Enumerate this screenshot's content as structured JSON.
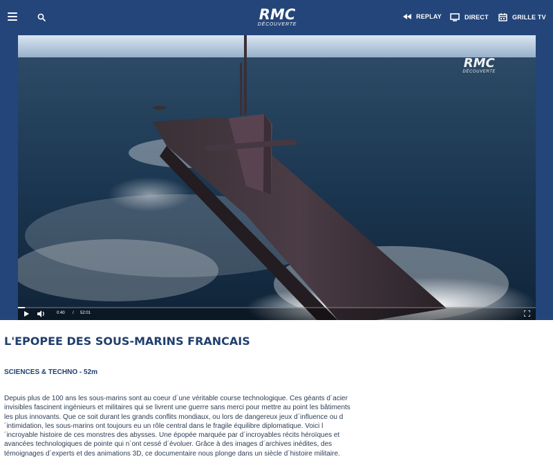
{
  "header": {
    "menu_icon": "hamburger-menu-icon",
    "search_icon": "search-icon",
    "logo": {
      "main": "RMC",
      "sub": "DÉCOUVERTE"
    },
    "nav": [
      {
        "label": "REPLAY",
        "icon": "rewind-icon"
      },
      {
        "label": "DIRECT",
        "icon": "tv-screen-icon"
      },
      {
        "label": "GRILLE TV",
        "icon": "calendar-icon"
      }
    ],
    "bg_color": "#23457a"
  },
  "player": {
    "watermark": {
      "main": "RMC",
      "sub": "DÉCOUVERTE"
    },
    "current_time": "0:40",
    "separator": "/",
    "duration": "52:01",
    "progress_fraction": 0.0128,
    "play_icon": "play-icon",
    "volume_icon": "volume-icon",
    "fullscreen_icon": "fullscreen-icon"
  },
  "program": {
    "title": "L'EPOPEE DES SOUS-MARINS FRANCAIS",
    "meta": "SCIENCES & TECHNO - 52m",
    "description": "Depuis plus de 100 ans les sous-marins sont au coeur d´une véritable course technologique. Ces géants d´acier invisibles fascinent ingénieurs et militaires qui se livrent une guerre sans merci pour mettre au point les bâtiments les plus innovants. Que ce soit durant les grands conflits mondiaux, ou lors de dangereux jeux d´influence ou d´intimidation, les sous-marins ont toujours eu un rôle central dans le fragile équilibre diplomatique. Voici l´incroyable histoire de ces monstres des abysses. Une épopée marquée par d´incroyables récits héroïques et avancées technologiques de pointe qui n´ont cessé d´évoluer. Grâce à des images d´archives inédites, des témoignages d´experts et des animations 3D, ce documentaire nous plonge dans un siècle d´histoire militaire.",
    "text_color": "#1f3f6e"
  }
}
